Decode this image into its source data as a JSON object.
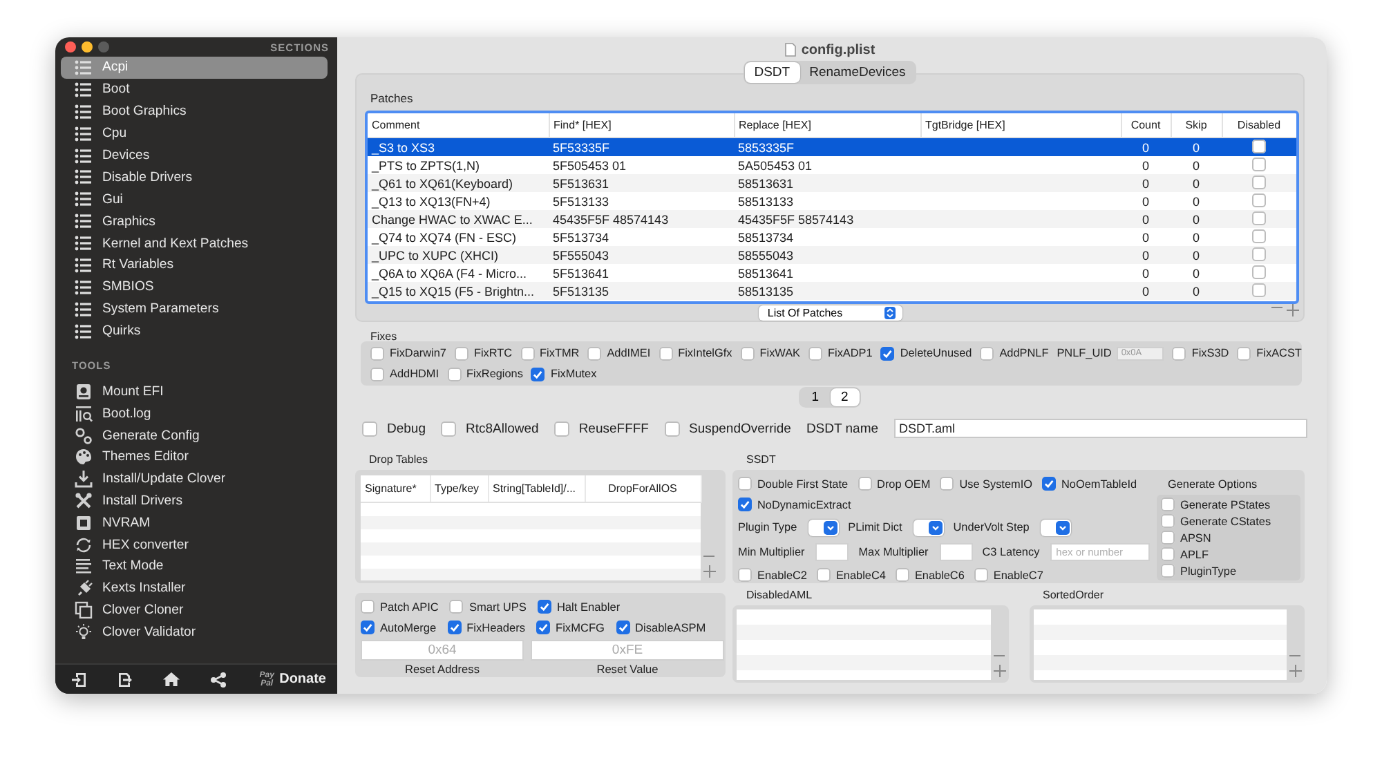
{
  "window": {
    "title": "config.plist"
  },
  "sidebar": {
    "sections_heading": "SECTIONS",
    "sections": [
      {
        "label": "Acpi",
        "selected": true
      },
      {
        "label": "Boot",
        "selected": false
      },
      {
        "label": "Boot Graphics",
        "selected": false
      },
      {
        "label": "Cpu",
        "selected": false
      },
      {
        "label": "Devices",
        "selected": false
      },
      {
        "label": "Disable Drivers",
        "selected": false
      },
      {
        "label": "Gui",
        "selected": false
      },
      {
        "label": "Graphics",
        "selected": false
      },
      {
        "label": "Kernel and Kext Patches",
        "selected": false
      },
      {
        "label": "Rt Variables",
        "selected": false
      },
      {
        "label": "SMBIOS",
        "selected": false
      },
      {
        "label": "System Parameters",
        "selected": false
      },
      {
        "label": "Quirks",
        "selected": false
      }
    ],
    "tools_heading": "TOOLS",
    "tools": [
      {
        "label": "Mount EFI"
      },
      {
        "label": "Boot.log"
      },
      {
        "label": "Generate Config"
      },
      {
        "label": "Themes Editor"
      },
      {
        "label": "Install/Update Clover"
      },
      {
        "label": "Install Drivers"
      },
      {
        "label": "NVRAM"
      },
      {
        "label": "HEX converter"
      },
      {
        "label": "Text Mode"
      },
      {
        "label": "Kexts Installer"
      },
      {
        "label": "Clover Cloner"
      },
      {
        "label": "Clover Validator"
      }
    ],
    "footer": {
      "paypal_label": "Pay Pal",
      "donate_label": "Donate"
    }
  },
  "tabs": [
    {
      "label": "DSDT",
      "selected": true
    },
    {
      "label": "RenameDevices",
      "selected": false
    }
  ],
  "patches": {
    "title": "Patches",
    "columns": [
      "Comment",
      "Find* [HEX]",
      "Replace [HEX]",
      "TgtBridge [HEX]",
      "Count",
      "Skip",
      "Disabled"
    ],
    "rows": [
      {
        "comment": "_S3 to XS3",
        "find": "5F53335F",
        "replace": "5853335F",
        "count": "0",
        "skip": "0",
        "disabled": false,
        "selected": true
      },
      {
        "comment": "_PTS to ZPTS(1,N)",
        "find": "5F505453 01",
        "replace": "5A505453 01",
        "count": "0",
        "skip": "0",
        "disabled": false,
        "selected": false
      },
      {
        "comment": "_Q61 to XQ61(Keyboard)",
        "find": "5F513631",
        "replace": "58513631",
        "count": "0",
        "skip": "0",
        "disabled": false,
        "selected": false
      },
      {
        "comment": "_Q13 to XQ13(FN+4)",
        "find": "5F513133",
        "replace": "58513133",
        "count": "0",
        "skip": "0",
        "disabled": false,
        "selected": false
      },
      {
        "comment": "Change HWAC to XWAC E...",
        "find": "45435F5F 48574143",
        "replace": "45435F5F 58574143",
        "count": "0",
        "skip": "0",
        "disabled": false,
        "selected": false
      },
      {
        "comment": "_Q74 to XQ74 (FN - ESC)",
        "find": "5F513734",
        "replace": "58513734",
        "count": "0",
        "skip": "0",
        "disabled": false,
        "selected": false
      },
      {
        "comment": "_UPC to XUPC (XHCI)",
        "find": "5F555043",
        "replace": "58555043",
        "count": "0",
        "skip": "0",
        "disabled": false,
        "selected": false
      },
      {
        "comment": "_Q6A to XQ6A (F4 - Micro...",
        "find": "5F513641",
        "replace": "58513641",
        "count": "0",
        "skip": "0",
        "disabled": false,
        "selected": false
      },
      {
        "comment": "_Q15 to XQ15 (F5 - Brightn...",
        "find": "5F513135",
        "replace": "58513135",
        "count": "0",
        "skip": "0",
        "disabled": false,
        "selected": false
      }
    ],
    "selector": "List Of Patches"
  },
  "fixes": {
    "title": "Fixes",
    "rows": [
      {
        "items": [
          {
            "kind": "checkbox",
            "label": "FixDarwin7",
            "checked": false
          },
          {
            "kind": "checkbox",
            "label": "FixRTC",
            "checked": false
          },
          {
            "kind": "checkbox",
            "label": "FixTMR",
            "checked": false
          },
          {
            "kind": "checkbox",
            "label": "AddIMEI",
            "checked": false
          },
          {
            "kind": "checkbox",
            "label": "FixIntelGfx",
            "checked": false
          },
          {
            "kind": "checkbox",
            "label": "FixWAK",
            "checked": false
          },
          {
            "kind": "checkbox",
            "label": "FixADP1",
            "checked": false
          },
          {
            "kind": "checkbox",
            "label": "DeleteUnused",
            "checked": true
          },
          {
            "kind": "checkbox",
            "label": "AddPNLF",
            "checked": false
          },
          {
            "kind": "field",
            "label": "PNLF_UID",
            "placeholder": "0x0A"
          },
          {
            "kind": "checkbox",
            "label": "FixS3D",
            "checked": false
          },
          {
            "kind": "checkbox",
            "label": "FixACST",
            "checked": false
          }
        ]
      },
      {
        "items": [
          {
            "kind": "checkbox",
            "label": "AddHDMI",
            "checked": false
          },
          {
            "kind": "checkbox",
            "label": "FixRegions",
            "checked": false
          },
          {
            "kind": "checkbox",
            "label": "FixMutex",
            "checked": true
          }
        ]
      }
    ]
  },
  "pages": [
    {
      "label": "1",
      "selected": false
    },
    {
      "label": "2",
      "selected": true
    }
  ],
  "options": [
    {
      "kind": "checkbox",
      "label": "Debug",
      "checked": false
    },
    {
      "kind": "checkbox",
      "label": "Rtc8Allowed",
      "checked": false
    },
    {
      "kind": "checkbox",
      "label": "ReuseFFFF",
      "checked": false
    },
    {
      "kind": "checkbox",
      "label": "SuspendOverride",
      "checked": false
    },
    {
      "kind": "field",
      "label": "DSDT name",
      "value": "DSDT.aml"
    }
  ],
  "drop_tables": {
    "title": "Drop Tables",
    "columns": [
      "Signature*",
      "Type/key",
      "String[TableId]/...",
      "DropForAllOS"
    ]
  },
  "acpi_flags": {
    "rows": [
      {
        "items": [
          {
            "label": "Patch APIC",
            "checked": false
          },
          {
            "label": "Smart UPS",
            "checked": false
          },
          {
            "label": "Halt Enabler",
            "checked": true
          }
        ]
      },
      {
        "items": [
          {
            "label": "AutoMerge",
            "checked": true
          },
          {
            "label": "FixHeaders",
            "checked": true
          },
          {
            "label": "FixMCFG",
            "checked": true
          },
          {
            "label": "DisableASPM",
            "checked": true
          }
        ]
      }
    ],
    "fields": [
      {
        "placeholder": "0x64",
        "caption": "Reset Address"
      },
      {
        "placeholder": "0xFE",
        "caption": "Reset Value"
      }
    ]
  },
  "ssdt": {
    "title": "SSDT",
    "rows": [
      {
        "items": [
          {
            "kind": "checkbox",
            "label": "Double First State",
            "checked": false
          },
          {
            "kind": "checkbox",
            "label": "Drop OEM",
            "checked": false
          },
          {
            "kind": "checkbox",
            "label": "Use SystemIO",
            "checked": false
          },
          {
            "kind": "checkbox",
            "label": "NoOemTableId",
            "checked": true
          }
        ]
      },
      {
        "items": [
          {
            "kind": "checkbox",
            "label": "NoDynamicExtract",
            "checked": true
          }
        ]
      },
      {
        "items": [
          {
            "kind": "popup",
            "label": "Plugin Type"
          },
          {
            "kind": "popup",
            "label": "PLimit Dict"
          },
          {
            "kind": "popup",
            "label": "UnderVolt Step"
          }
        ]
      },
      {
        "items": [
          {
            "kind": "field",
            "label": "Min Multiplier"
          },
          {
            "kind": "field",
            "label": "Max Multiplier"
          },
          {
            "kind": "wide-field",
            "label": "C3 Latency",
            "placeholder": "hex or number"
          }
        ]
      },
      {
        "items": [
          {
            "kind": "checkbox",
            "label": "EnableC2",
            "checked": false
          },
          {
            "kind": "checkbox",
            "label": "EnableC4",
            "checked": false
          },
          {
            "kind": "checkbox",
            "label": "EnableC6",
            "checked": false
          },
          {
            "kind": "checkbox",
            "label": "EnableC7",
            "checked": false
          }
        ]
      }
    ],
    "generate_options": {
      "title": "Generate Options",
      "items": [
        {
          "label": "Generate PStates",
          "checked": false
        },
        {
          "label": "Generate CStates",
          "checked": false
        },
        {
          "label": "APSN",
          "checked": false
        },
        {
          "label": "APLF",
          "checked": false
        },
        {
          "label": "PluginType",
          "checked": false
        }
      ]
    }
  },
  "disabled_aml": {
    "title": "DisabledAML"
  },
  "sorted_order": {
    "title": "SortedOrder"
  }
}
